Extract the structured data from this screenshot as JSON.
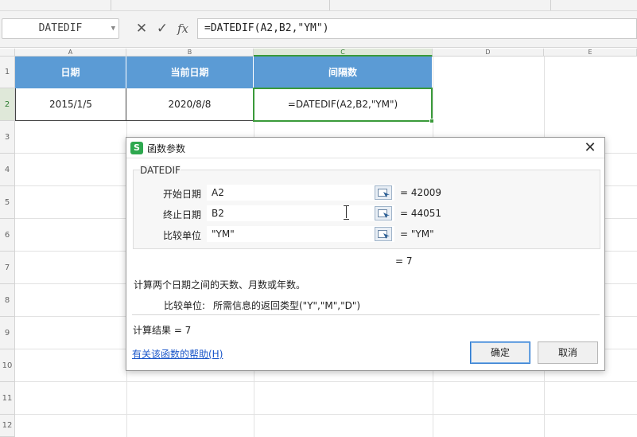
{
  "formula_bar": {
    "name_box": "DATEDIF",
    "formula": "=DATEDIF(A2,B2,\"YM\")",
    "cancel_glyph": "✕",
    "confirm_glyph": "✓",
    "fx_label": "fx"
  },
  "sheet": {
    "columns": [
      "A",
      "B",
      "C",
      "D",
      "E"
    ],
    "rows": [
      "1",
      "2",
      "3",
      "4",
      "5",
      "6",
      "7",
      "8",
      "9",
      "10",
      "11",
      "12"
    ],
    "headers": [
      "日期",
      "当前日期",
      "间隔数"
    ],
    "row2": [
      "2015/1/5",
      "2020/8/8",
      "=DATEDIF(A2,B2,\"YM\")"
    ]
  },
  "dialog": {
    "title": "函数参数",
    "close_glyph": "✕",
    "function_name": "DATEDIF",
    "args": [
      {
        "label": "开始日期",
        "value": "A2",
        "result": "=  42009"
      },
      {
        "label": "终止日期",
        "value": "B2",
        "result": "=  44051"
      },
      {
        "label": "比较单位",
        "value": "\"YM\"",
        "result": "=  \"YM\""
      }
    ],
    "function_result": "=  7",
    "description": "计算两个日期之间的天数、月数或年数。",
    "param_desc_label": "比较单位:",
    "param_desc_text": "所需信息的返回类型(\"Y\",\"M\",\"D\")",
    "calc_result": "计算结果  =  7",
    "help_link": "有关该函数的帮助(H)",
    "ok_label": "确定",
    "cancel_label": "取消"
  },
  "colors": {
    "header_fill": "#5b9bd5",
    "selection_green": "#3a9a3a",
    "link_blue": "#1a56c9"
  }
}
